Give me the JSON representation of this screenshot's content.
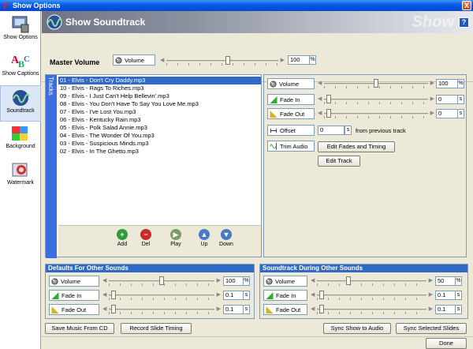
{
  "window": {
    "title": "Show Options",
    "close_label": "X"
  },
  "sidebar": {
    "items": [
      {
        "label": "Show Options",
        "icon": "show-options-icon"
      },
      {
        "label": "Show Captions",
        "icon": "captions-icon"
      },
      {
        "label": "Soundtrack",
        "icon": "soundtrack-icon"
      },
      {
        "label": "Background",
        "icon": "background-icon"
      },
      {
        "label": "Watermark",
        "icon": "watermark-icon"
      }
    ],
    "selected_index": 2
  },
  "header": {
    "title": "Show Soundtrack",
    "watermark": "Show",
    "help_label": "?"
  },
  "master": {
    "label": "Master Volume",
    "volume_label": "Volume",
    "value": "100",
    "unit": "%"
  },
  "tracks": {
    "tab_label": "Tracks",
    "items": [
      "01 - Elvis - Don't Cry Daddy.mp3",
      "10 - Elvis - Rags To Riches.mp3",
      "09 - Elvis - I Just Can't Help Bellevin'.mp3",
      "08 - Elvis - You Don't Have To Say You Love Me.mp3",
      "07 - Elvis - I've Lost You.mp3",
      "06 - Elvis - Kentucky Rain.mp3",
      "05 - Elvis - Polk Salad Annie.mp3",
      "04 - Elvis - The Wonder Of You.mp3",
      "03 - Elvis - Suspicious Minds.mp3",
      "02 - Elvis - In The Ghetto.mp3"
    ],
    "selected_index": 0,
    "toolbar": {
      "add": "Add",
      "del": "Del",
      "play": "Play",
      "up": "Up",
      "down": "Down"
    }
  },
  "track_settings": {
    "volume_label": "Volume",
    "volume_value": "100",
    "volume_unit": "%",
    "fadein_label": "Fade In",
    "fadein_value": "0",
    "fadein_unit": "s",
    "fadeout_label": "Fade Out",
    "fadeout_value": "0",
    "fadeout_unit": "s",
    "offset_label": "Offset",
    "offset_value": "0",
    "offset_unit": "s",
    "offset_suffix": "from previous track",
    "trim_label": "Trim Audio",
    "edit_fades_label": "Edit Fades and Timing",
    "edit_track_label": "Edit Track"
  },
  "defaults": {
    "title": "Defaults For Other Sounds",
    "volume_label": "Volume",
    "volume_value": "100",
    "volume_unit": "%",
    "fadein_label": "Fade In",
    "fadein_value": "0.1",
    "fadein_unit": "s",
    "fadeout_label": "Fade Out",
    "fadeout_value": "0.1",
    "fadeout_unit": "s"
  },
  "during": {
    "title": "Soundtrack During Other Sounds",
    "volume_label": "Volume",
    "volume_value": "50",
    "volume_unit": "%",
    "fadein_label": "Fade In",
    "fadein_value": "0.1",
    "fadein_unit": "s",
    "fadeout_label": "Fade Out",
    "fadeout_value": "0.1",
    "fadeout_unit": "s"
  },
  "buttons": {
    "save_cd": "Save Music From CD",
    "record_timing": "Record Slide Timing",
    "sync_show": "Sync Show to Audio",
    "sync_selected": "Sync Selected Slides",
    "done": "Done"
  },
  "levels": {
    "master_volume": 0.55,
    "track_volume": 0.5,
    "track_fadein": 0.02,
    "track_fadeout": 0.02,
    "defaults_volume": 0.5,
    "defaults_fadein": 0.02,
    "defaults_fadeout": 0.02,
    "during_volume": 0.28,
    "during_fadein": 0.02,
    "during_fadeout": 0.02
  },
  "colors": {
    "accent": "#316ac5",
    "titlebar": "#0054e3",
    "tracks_tab": "#3b6fe0"
  }
}
